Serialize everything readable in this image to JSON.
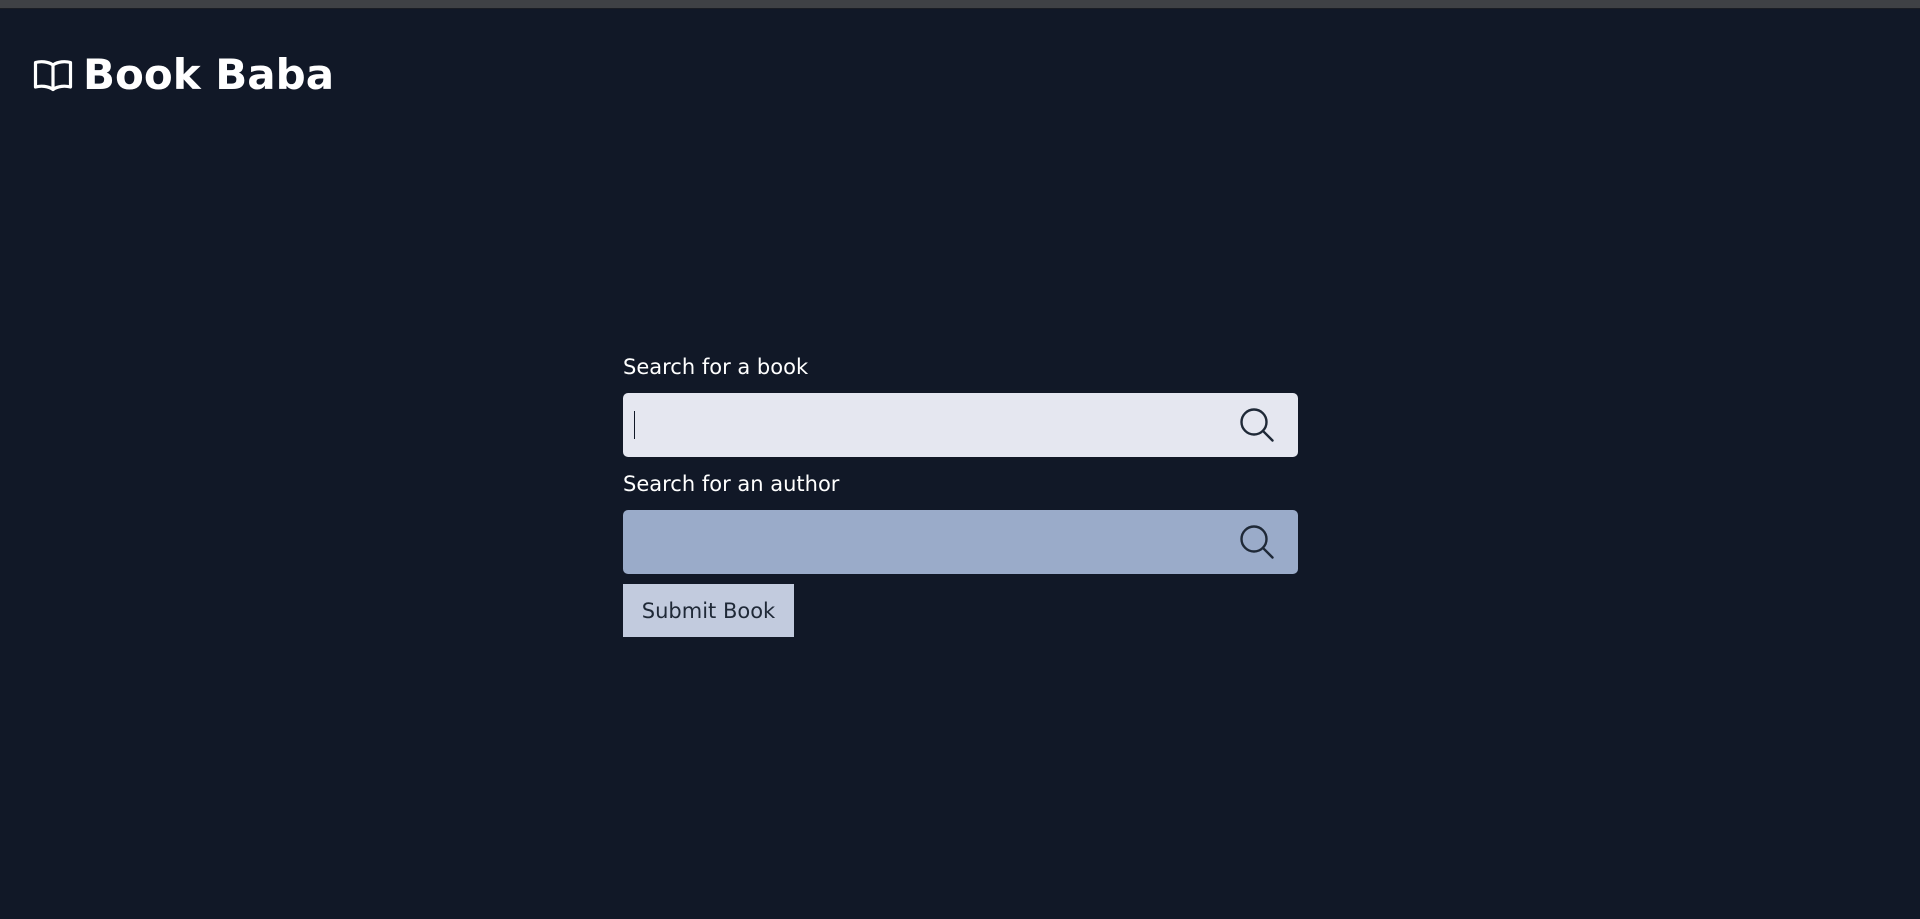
{
  "brand": {
    "icon": "open-book-icon",
    "title": "Book Baba"
  },
  "book_search": {
    "label": "Search for a book",
    "value": "",
    "placeholder": "",
    "icon": "search-icon",
    "focused": true
  },
  "author_search": {
    "label": "Search for an author",
    "value": "",
    "placeholder": "",
    "icon": "search-icon"
  },
  "submit": {
    "label": "Submit Book"
  },
  "colors": {
    "background": "#111827",
    "book_field": "#e5e7f0",
    "author_field": "#9aabc9",
    "button": "#c2cbde",
    "text": "#ffffff"
  }
}
